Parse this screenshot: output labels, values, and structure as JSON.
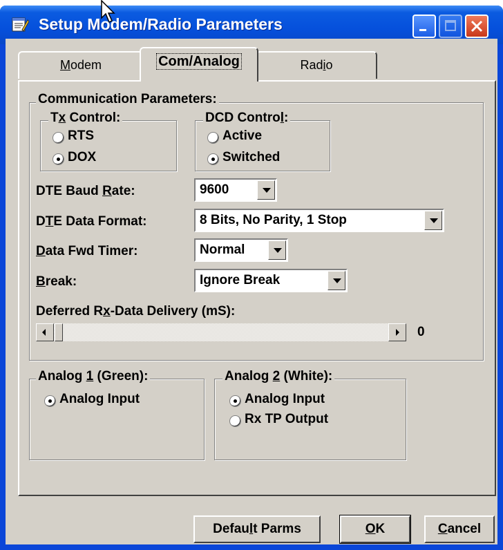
{
  "window": {
    "title": "Setup Modem/Radio Parameters",
    "title_icon": "notepad-icon",
    "controls": [
      "minimize-icon",
      "maximize-icon",
      "close-icon"
    ],
    "colors": {
      "titlebar": "#0550dc",
      "client": "#d4d0c8",
      "close": "#c8381a"
    }
  },
  "tabs": [
    {
      "label": "Modem",
      "mnemonic": "M",
      "rest": "odem",
      "active": false
    },
    {
      "label": "Com/Analog",
      "active": true
    },
    {
      "label": "Radio",
      "mnemonic": "i",
      "pre": "Rad",
      "post": "o",
      "active": false
    }
  ],
  "communication": {
    "legend": "Communication Parameters:",
    "tx_control": {
      "legend_pre": "T",
      "legend_mn": "x",
      "legend_post": " Control:",
      "options": [
        {
          "label": "RTS",
          "selected": false
        },
        {
          "label": "DOX",
          "selected": true
        }
      ]
    },
    "dcd_control": {
      "legend_pre": "DCD Contro",
      "legend_mn": "l",
      "legend_post": ":",
      "options": [
        {
          "label": "Active",
          "selected": false
        },
        {
          "label": "Switched",
          "selected": true
        }
      ]
    },
    "fields": [
      {
        "label_pre": "DTE Baud ",
        "label_mn": "R",
        "label_post": "ate:",
        "value": "9600"
      },
      {
        "label_pre": "D",
        "label_mn": "T",
        "label_post": "E Data Format:",
        "value": "8 Bits, No Parity, 1 Stop"
      },
      {
        "label_pre": "",
        "label_mn": "D",
        "label_post": "ata Fwd Timer:",
        "value": "Normal"
      },
      {
        "label_pre": "",
        "label_mn": "B",
        "label_post": "reak:",
        "value": "Ignore Break"
      }
    ],
    "deferred": {
      "label_pre": "Deferred R",
      "label_mn": "x",
      "label_post": "-Data Delivery (mS):",
      "value": "0"
    }
  },
  "analog1": {
    "legend_pre": "Analog ",
    "legend_mn": "1",
    "legend_post": " (Green):",
    "options": [
      {
        "label": "Analog Input",
        "selected": true
      }
    ]
  },
  "analog2": {
    "legend_pre": "Analog ",
    "legend_mn": "2",
    "legend_post": " (White):",
    "options": [
      {
        "label": "Analog Input",
        "selected": true
      },
      {
        "label": "Rx TP Output",
        "selected": false
      }
    ]
  },
  "buttons": {
    "default_pre": "Defau",
    "default_mn": "l",
    "default_post": "t Parms",
    "ok_mn": "O",
    "ok_post": "K",
    "cancel_mn": "C",
    "cancel_post": "ancel"
  }
}
